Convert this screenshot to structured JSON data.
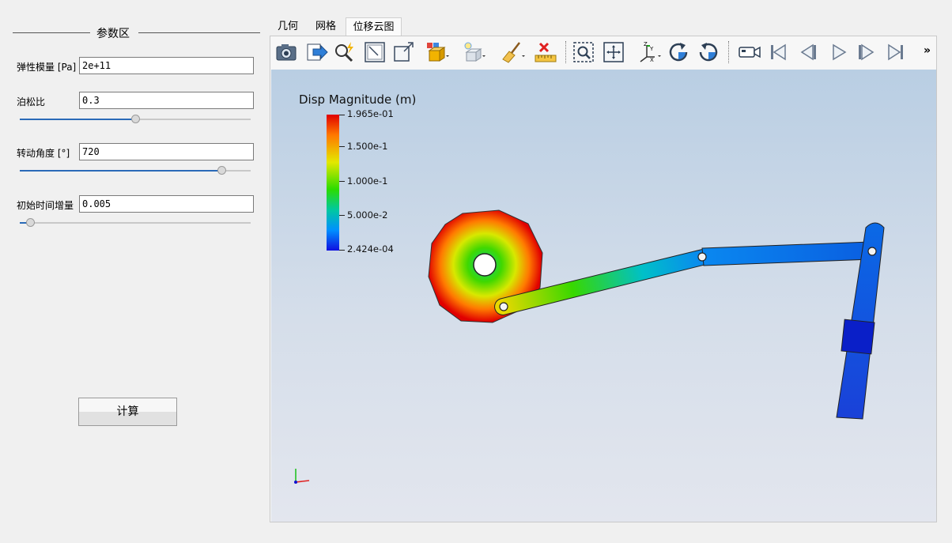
{
  "params": {
    "group_title": "参数区",
    "youngs_modulus": {
      "label": "弹性模量 [Pa]",
      "value": "2e+11"
    },
    "poisson": {
      "label": "泊松比",
      "value": "0.3",
      "slider_fraction": 0.5
    },
    "rotation": {
      "label": "转动角度 [°]",
      "value": "720",
      "slider_fraction": 0.89
    },
    "time_step": {
      "label": "初始时间增量",
      "value": "0.005",
      "slider_fraction": 0.03
    },
    "compute_label": "计算"
  },
  "tabs": [
    {
      "label": "几何",
      "active": false
    },
    {
      "label": "网格",
      "active": false
    },
    {
      "label": "位移云图",
      "active": true
    }
  ],
  "toolbar": {
    "icons": [
      "camera-icon",
      "export-icon",
      "interactive-select-icon",
      "reset-camera-closest-icon",
      "reset-camera-icon",
      "representation-icon",
      "light-icon",
      "clear-icon",
      "ruler-icon",
      "zoom-to-box-icon",
      "zoom-data-icon",
      "axes-orientation-icon",
      "rotate-cw-icon",
      "rotate-ccw-icon",
      "camera-record-icon",
      "first-frame-icon",
      "prev-frame-icon",
      "play-icon",
      "next-frame-icon",
      "last-frame-icon"
    ],
    "overflow_label": "»"
  },
  "colorbar": {
    "title": "Disp Magnitude (m)",
    "labels": [
      "1.965e-01",
      "1.500e-1",
      "1.000e-1",
      "5.000e-2",
      "2.424e-04"
    ],
    "colors": [
      "#e00000",
      "#ff7800",
      "#e4e800",
      "#2cdc00",
      "#00c8a0",
      "#0090ff",
      "#1010e0"
    ]
  }
}
